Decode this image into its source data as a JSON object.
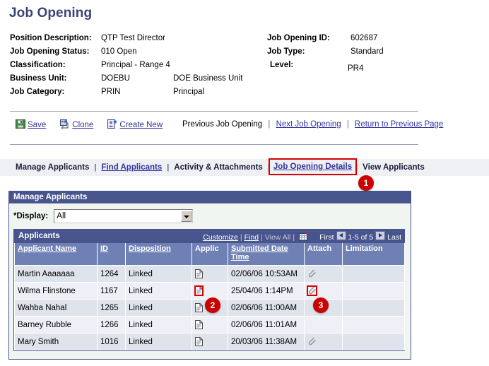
{
  "page": {
    "title": "Job Opening",
    "accent_color": "#3b4575",
    "header_bar_color": "#48548c",
    "grid_header_color": "#6f80b4",
    "annotation_color": "#cc0000"
  },
  "details": {
    "left": [
      {
        "label": "Position Description:",
        "value": "QTP Test Director",
        "value2": ""
      },
      {
        "label": "Job Opening Status:",
        "value": "010 Open",
        "value2": ""
      },
      {
        "label": "Classification:",
        "value": "Principal - Range 4",
        "value2": ""
      },
      {
        "label": "Business Unit:",
        "value": "DOEBU",
        "value2": "DOE Business Unit"
      },
      {
        "label": "Job Category:",
        "value": "PRIN",
        "value2": "Principal"
      }
    ],
    "right": [
      {
        "label": "Job Opening ID:",
        "value": "602687"
      },
      {
        "label": "Job Type:",
        "value": "Standard"
      },
      {
        "label": "Level:",
        "value": "PR4"
      }
    ]
  },
  "toolbar": {
    "save_label": "Save",
    "clone_label": "Clone",
    "create_new_label": "Create New",
    "save_icon": "floppy-disk-icon",
    "clone_icon": "clone-icon",
    "create_new_icon": "create-new-icon"
  },
  "nav": {
    "previous_label": "Previous Job Opening",
    "next_label": "Next Job Opening",
    "return_label": "Return to Previous Page",
    "separator": "|"
  },
  "tabs": [
    {
      "label": "Manage Applicants",
      "link": false,
      "highlighted": false
    },
    {
      "label": "Find Applicants",
      "link": true,
      "highlighted": false
    },
    {
      "label": "Activity & Attachments",
      "link": false,
      "highlighted": false
    },
    {
      "label": "Job Opening Details",
      "link": true,
      "highlighted": true
    },
    {
      "label": "View Applicants",
      "link": false,
      "highlighted": false
    }
  ],
  "tab_separator": "|",
  "groupbox": {
    "title": "Manage Applicants",
    "display_label": "*Display:",
    "display_value": "All",
    "display_options": [
      "All"
    ]
  },
  "grid": {
    "title": "Applicants",
    "customize_label": "Customize",
    "find_label": "Find",
    "view_all_label": "View All",
    "grid_icon": "spreadsheet-icon",
    "first_label": "First",
    "last_label": "Last",
    "range_label": "1-5 of 5",
    "prev_icon": "left-arrow-icon",
    "next_icon": "right-arrow-icon",
    "columns": [
      {
        "label": "Applicant Name",
        "link": true
      },
      {
        "label": "ID",
        "link": true
      },
      {
        "label": "Disposition",
        "link": true
      },
      {
        "label": "Applic",
        "link": false
      },
      {
        "label": "Submitted Date Time",
        "link": true
      },
      {
        "label": "Attach",
        "link": false
      },
      {
        "label": "Limitation",
        "link": false
      }
    ],
    "rows": [
      {
        "name": "Martin Aaaaaaa",
        "id": "1264",
        "disposition": "Linked",
        "applic_icon": "document-icon",
        "submitted": "02/06/06 10:53AM",
        "attach_icon": "paperclip-icon",
        "limitation": "",
        "applic_highlighted": false,
        "attach_highlighted": false
      },
      {
        "name": "Wilma Flinstone",
        "id": "1167",
        "disposition": "Linked",
        "applic_icon": "document-icon",
        "submitted": "25/04/06  1:14PM",
        "attach_icon": "paperclip-icon",
        "limitation": "",
        "applic_highlighted": true,
        "attach_highlighted": true
      },
      {
        "name": "Wahba Nahal",
        "id": "1265",
        "disposition": "Linked",
        "applic_icon": "document-icon",
        "submitted": "02/06/06 11:00AM",
        "attach_icon": "",
        "limitation": "",
        "applic_highlighted": false,
        "attach_highlighted": false
      },
      {
        "name": "Barney Rubble",
        "id": "1266",
        "disposition": "Linked",
        "applic_icon": "document-icon",
        "submitted": "02/06/06 11:01AM",
        "attach_icon": "",
        "limitation": "",
        "applic_highlighted": false,
        "attach_highlighted": false
      },
      {
        "name": "Mary Smith",
        "id": "1016",
        "disposition": "Linked",
        "applic_icon": "document-icon",
        "submitted": "20/03/06 11:38AM",
        "attach_icon": "paperclip-icon",
        "limitation": "",
        "applic_highlighted": false,
        "attach_highlighted": false
      }
    ]
  },
  "annotations": [
    {
      "number": "1",
      "target": "tab-job-opening-details"
    },
    {
      "number": "2",
      "target": "applic-column-icon"
    },
    {
      "number": "3",
      "target": "attach-column-icon"
    }
  ]
}
